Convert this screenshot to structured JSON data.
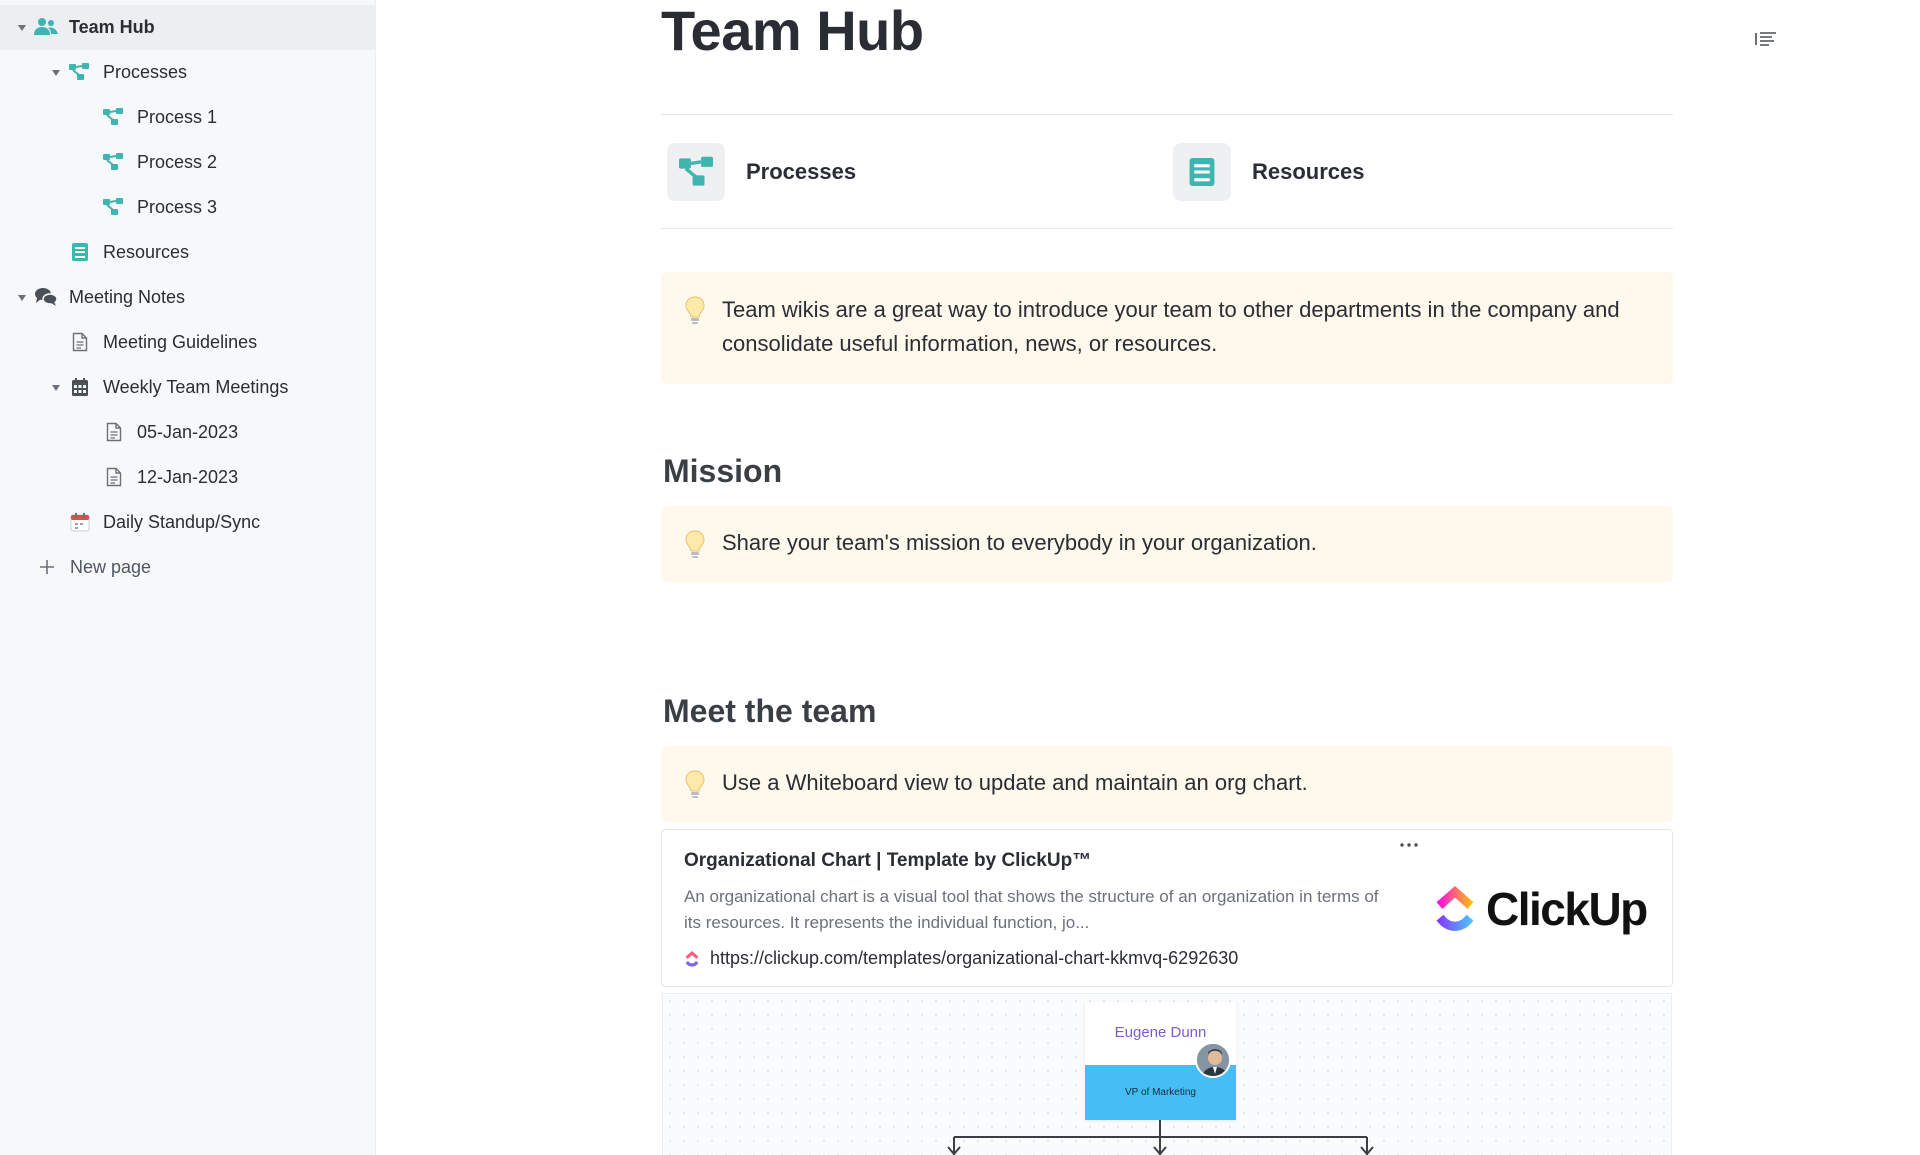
{
  "sidebar": {
    "items": [
      {
        "label": "Team Hub"
      },
      {
        "label": "Processes"
      },
      {
        "label": "Process 1"
      },
      {
        "label": "Process 2"
      },
      {
        "label": "Process 3"
      },
      {
        "label": "Resources"
      },
      {
        "label": "Meeting Notes"
      },
      {
        "label": "Meeting Guidelines"
      },
      {
        "label": "Weekly Team Meetings"
      },
      {
        "label": "05-Jan-2023"
      },
      {
        "label": "12-Jan-2023"
      },
      {
        "label": "Daily Standup/Sync"
      }
    ],
    "new_page_label": "New page"
  },
  "page": {
    "title": "Team Hub",
    "link_cards": [
      {
        "label": "Processes",
        "icon": "flow-icon"
      },
      {
        "label": "Resources",
        "icon": "book-icon"
      }
    ],
    "intro_callout": "Team wikis are a great way to introduce your team to other departments in the company and consolidate useful information, news, or resources.",
    "mission": {
      "heading": "Mission",
      "callout": "Share your team's mission to everybody in your organization."
    },
    "team": {
      "heading": "Meet the team",
      "callout": "Use a Whiteboard view to update and maintain an org chart."
    },
    "bookmark": {
      "title": "Organizational Chart | Template by ClickUp™",
      "description": "An organizational chart is a visual tool that shows the structure of an organization in terms of its resources. It represents the individual function, jo...",
      "url": "https://clickup.com/templates/organizational-chart-kkmvq-6292630",
      "logo_text": "ClickUp"
    },
    "org_chart": {
      "name": "Eugene Dunn",
      "role": "VP of Marketing"
    }
  },
  "colors": {
    "accent_teal": "#3fb4b0",
    "callout_bg": "#fff8ec",
    "sidebar_bg": "#f7f8f9",
    "org_name": "#7b5cd6",
    "org_role_bar": "#45bdf5"
  }
}
